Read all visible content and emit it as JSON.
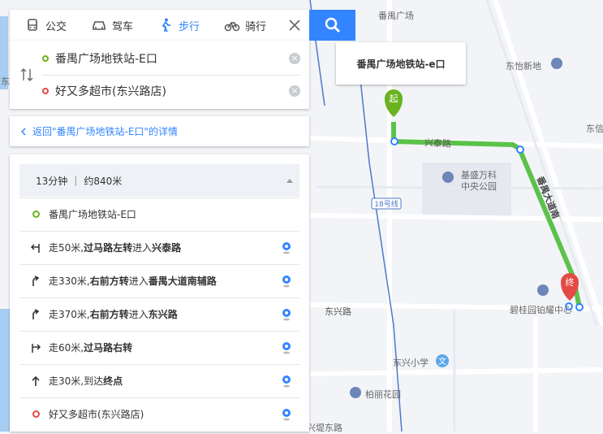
{
  "modes": [
    {
      "label": "公交",
      "icon": "bus-icon"
    },
    {
      "label": "驾车",
      "icon": "car-icon"
    },
    {
      "label": "步行",
      "icon": "walk-icon",
      "active": true
    },
    {
      "label": "骑行",
      "icon": "bike-icon"
    }
  ],
  "route": {
    "start": "番禺广场地铁站-E口",
    "end": "好又多超市(东兴路店)"
  },
  "back_link": "返回\"番禺广场地铁站-E口\"的详情",
  "summary": {
    "time": "13分钟",
    "distance": "约840米"
  },
  "steps": [
    {
      "prefix": "番禺广场地铁站-E口",
      "bold": "",
      "suffix": "",
      "type": "start"
    },
    {
      "prefix": "走50米,",
      "bold": "过马路左转",
      "mid": "进入",
      "bold2": "兴泰路",
      "type": "cross-left"
    },
    {
      "prefix": "走330米,",
      "bold": "右前方转",
      "mid": "进入",
      "bold2": "番禺大道南辅路",
      "type": "bear-right"
    },
    {
      "prefix": "走370米,",
      "bold": "右前方转",
      "mid": "进入",
      "bold2": "东兴路",
      "type": "bear-right"
    },
    {
      "prefix": "走60米,",
      "bold": "过马路右转",
      "mid": "",
      "bold2": "",
      "type": "cross-right"
    },
    {
      "prefix": "走30米,",
      "bold": "",
      "mid": "到达",
      "bold2": "终点",
      "type": "straight"
    },
    {
      "prefix": "好又多超市(东兴路店)",
      "bold": "",
      "suffix": "",
      "type": "end"
    }
  ],
  "map": {
    "callout": "番禺广场地铁站-e口",
    "start_marker": "起",
    "end_marker": "终",
    "labels": {
      "panyu_square": "番禺广场",
      "dongyi": "东怡新地",
      "dongxin": "东信",
      "xingtai_road": "兴泰路",
      "jisheng_park": "基盛万科\n中央公园",
      "panyu_avenue": "番禺大道南",
      "line18": "18号线",
      "dongxing_road": "东兴路",
      "biguiyuan": "碧桂园铂耀中心",
      "dongxing_school": "东兴小学",
      "baiyi_garden": "柏丽花园",
      "left_frag": "东,",
      "bottom_frag": "兴堤东路"
    }
  },
  "colors": {
    "accent": "#3385ff",
    "route": "#5bc24a",
    "start": "#6ab320",
    "end": "#e34a46"
  }
}
